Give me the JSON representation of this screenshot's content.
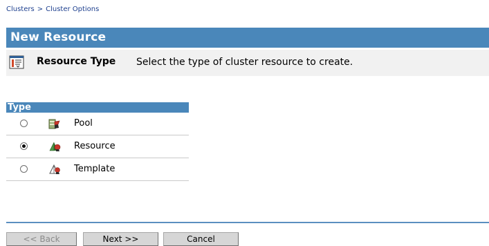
{
  "breadcrumb": {
    "items": [
      "Clusters",
      "Cluster Options"
    ],
    "separator": ">"
  },
  "page": {
    "title": "New Resource",
    "description_label": "Resource Type",
    "description_text": "Select the type of cluster resource to create."
  },
  "type_table": {
    "header": "Type",
    "options": [
      {
        "label": "Pool",
        "icon": "pool-icon",
        "selected": false
      },
      {
        "label": "Resource",
        "icon": "resource-icon",
        "selected": true
      },
      {
        "label": "Template",
        "icon": "template-icon",
        "selected": false
      }
    ]
  },
  "buttons": {
    "back": "<< Back",
    "next": "Next >>",
    "cancel": "Cancel"
  },
  "colors": {
    "accent": "#4a87ba",
    "breadcrumb": "#1d3f8e",
    "description_bg": "#f1f1f1"
  }
}
